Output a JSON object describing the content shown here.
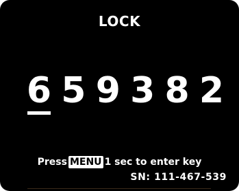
{
  "title": "LOCK",
  "code": {
    "digits": [
      "6",
      "5",
      "9",
      "3",
      "8",
      "2"
    ],
    "active_index": 0
  },
  "instruction": {
    "before": "Press",
    "key": "MENU",
    "after": "1 sec to enter key"
  },
  "serial": "SN: 111-467-539",
  "colors": {
    "background": "#000000",
    "text": "#ffffff",
    "key_background": "#ffffff",
    "key_text": "#000000"
  }
}
